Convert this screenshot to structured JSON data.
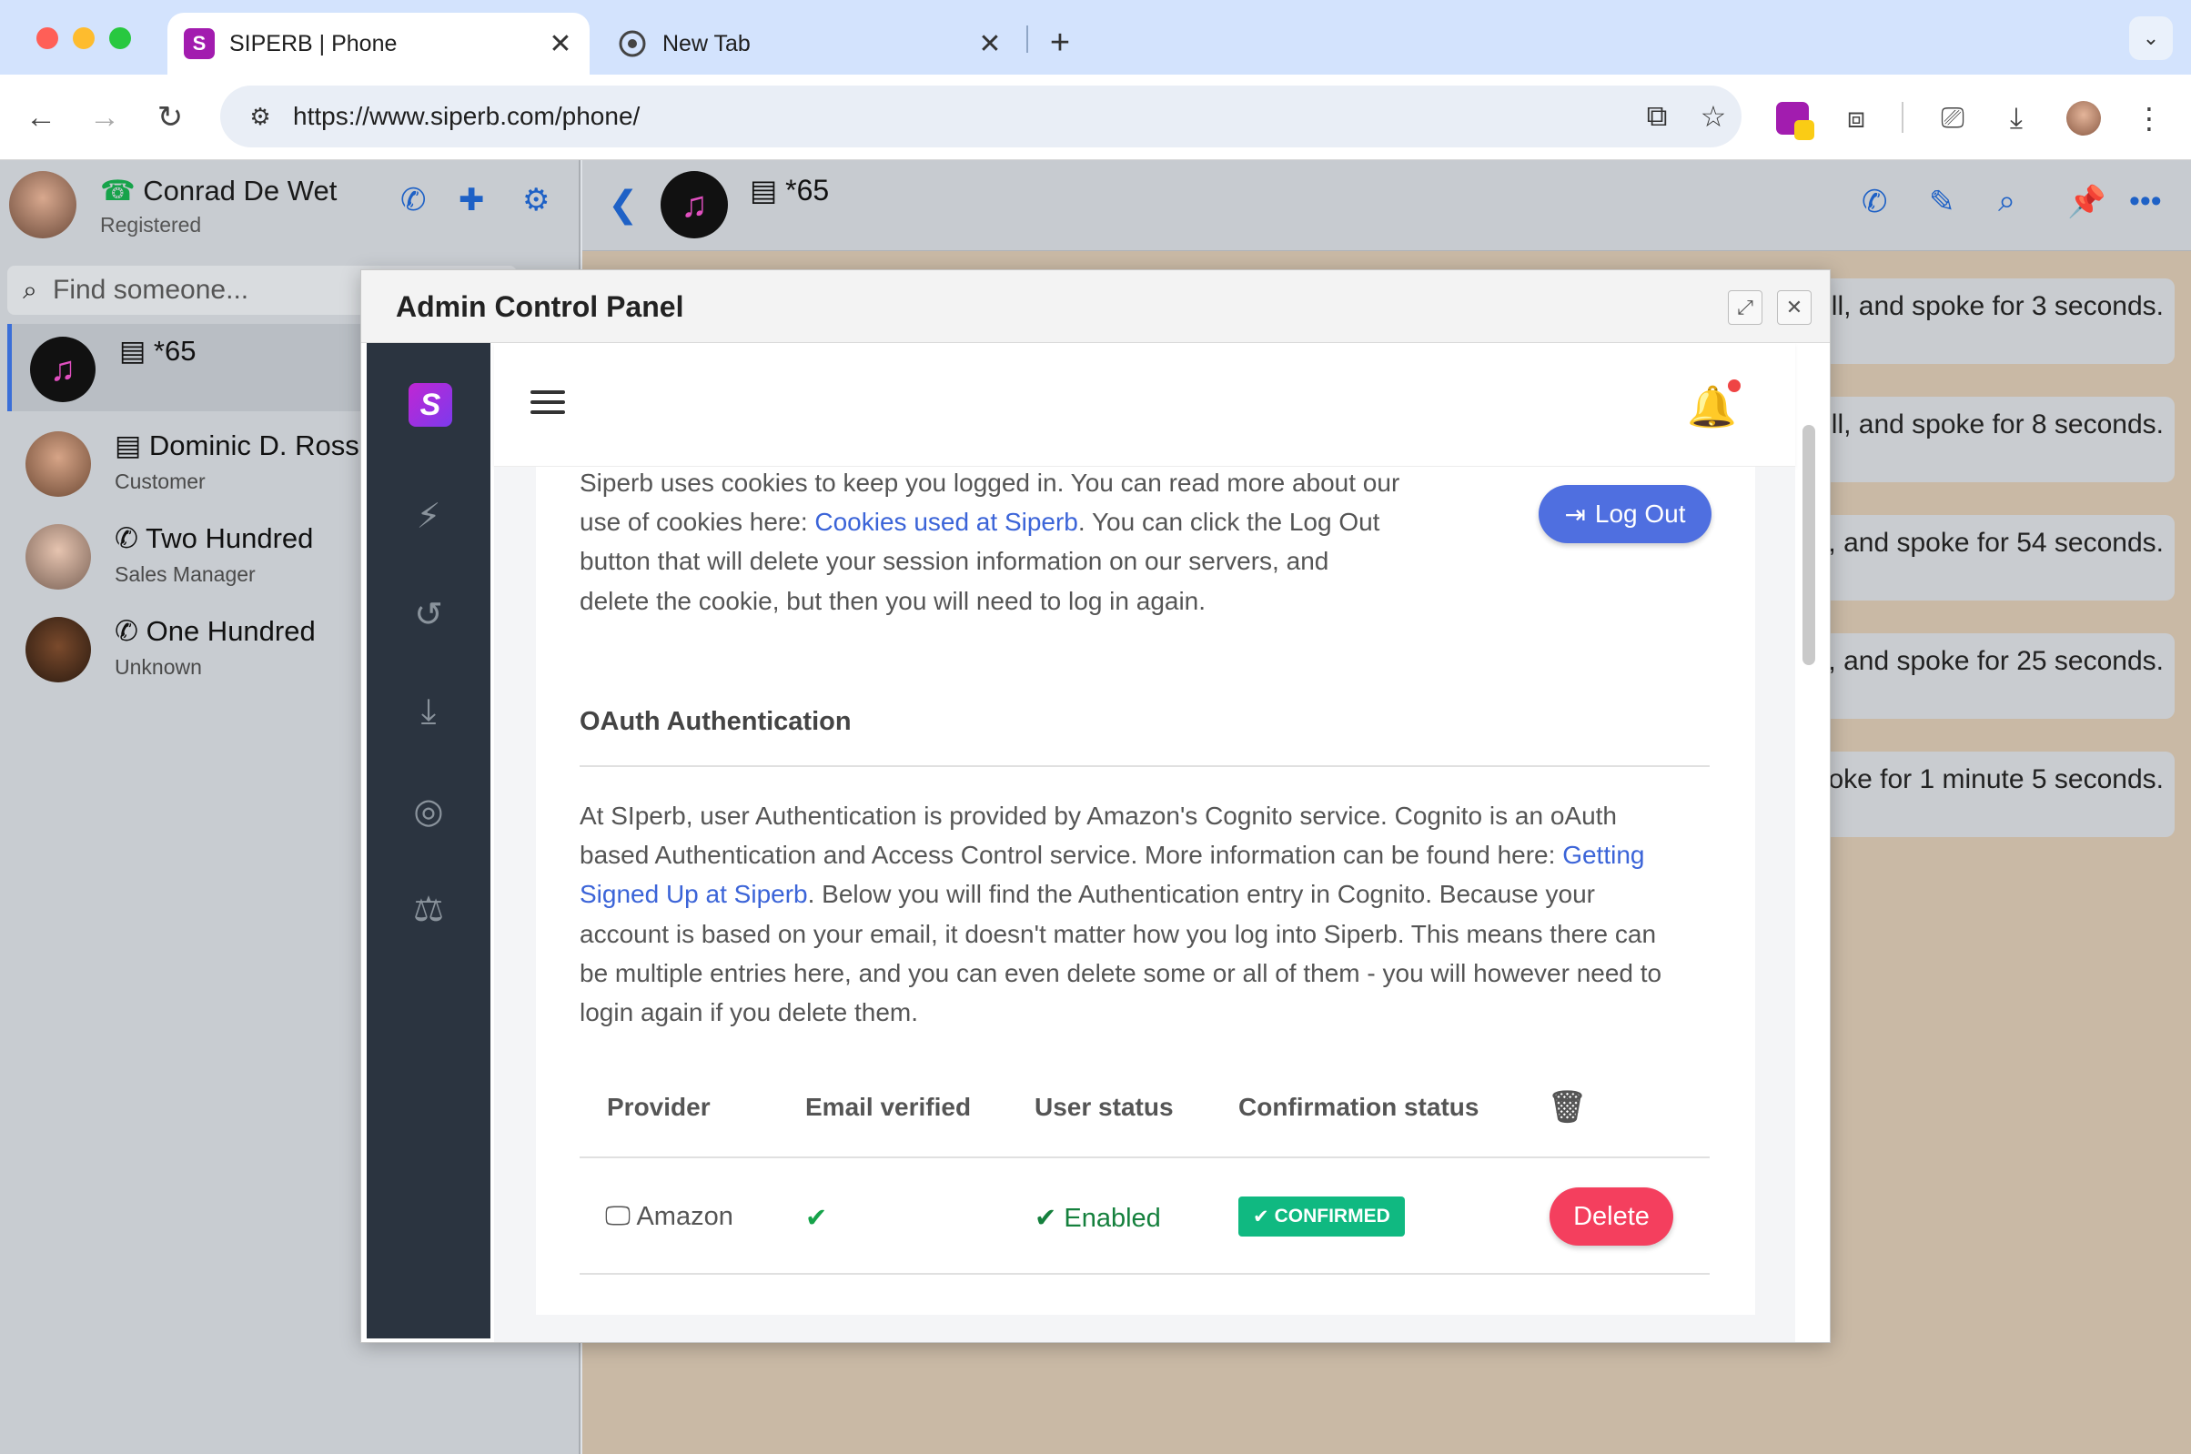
{
  "browser": {
    "tabs": [
      {
        "title": "SIPERB | Phone",
        "active": true
      },
      {
        "title": "New Tab",
        "active": false
      }
    ],
    "url": "https://www.siperb.com/phone/"
  },
  "sidebar": {
    "user": {
      "name": "Conrad De Wet",
      "status": "Registered"
    },
    "search_placeholder": "Find someone...",
    "contacts": [
      {
        "name": "*65",
        "subtitle": ""
      },
      {
        "name": "Dominic D. Rossi",
        "subtitle": "Customer"
      },
      {
        "name": "Two Hundred",
        "subtitle": "Sales Manager"
      },
      {
        "name": "One Hundred",
        "subtitle": "Unknown"
      }
    ]
  },
  "chat": {
    "title": "*65",
    "messages": [
      "ll, and spoke for 3 seconds.",
      "ll, and spoke for 8 seconds.",
      ", and spoke for 54 seconds.",
      ", and spoke for 25 seconds.",
      "oke for 1 minute 5 seconds."
    ]
  },
  "modal": {
    "title": "Admin Control Panel",
    "cookies": {
      "text_1": "Siperb uses cookies to keep you logged in. You can read more about our",
      "text_2a": "use of cookies here: ",
      "link": "Cookies used at Siperb",
      "text_2b": ". You can click the Log Out",
      "text_3": "button that will delete your session information on our servers, and",
      "text_4": "delete the cookie, but then you will need to log in again.",
      "logout_label": "Log Out"
    },
    "oauth": {
      "heading": "OAuth Authentication",
      "line_1": "At SIperb, user Authentication is provided by Amazon's Cognito service. Cognito is an oAuth",
      "line_2a": "based Authentication and Access Control service. More information can be found here: ",
      "link_part1": "Getting",
      "link_part2": "Signed Up at Siperb",
      "line_3b": ". Below you will find the Authentication entry in Cognito. Because your",
      "line_4": "account is based on your email, it doesn't matter how you log into Siperb. This means there can",
      "line_5": "be multiple entries here, and you can even delete some or all of them - you will however need to",
      "line_6": "login again if you delete them."
    },
    "table": {
      "headers": [
        "Provider",
        "Email verified",
        "User status",
        "Confirmation status"
      ],
      "row": {
        "provider": "Amazon",
        "user_status": "Enabled",
        "confirmation": "CONFIRMED",
        "delete_label": "Delete"
      }
    }
  },
  "colors": {
    "accent": "#1e61c6",
    "success": "#10b981",
    "danger": "#f43f5e",
    "logout": "#4f6fe0"
  }
}
